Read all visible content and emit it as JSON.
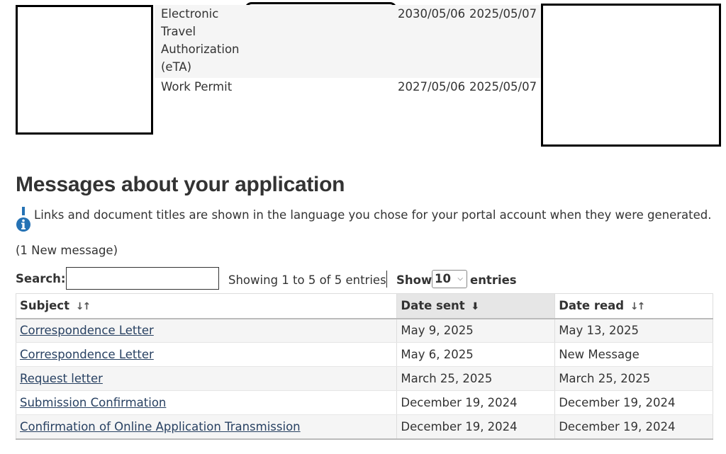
{
  "documents": {
    "rows": [
      {
        "type_lines": [
          "Electronic",
          "Travel",
          "Authorization",
          "(eTA)"
        ],
        "expiry": "2030/05/06",
        "issued": "2025/05/07"
      },
      {
        "type_lines": [
          "Work Permit"
        ],
        "expiry": "2027/05/06",
        "issued": "2025/05/07"
      }
    ]
  },
  "messages": {
    "title": "Messages about your application",
    "note": "Links and document titles are shown in the language you chose for your portal account when they were generated.",
    "new_count": "(1 New message)",
    "search_label": "Search:",
    "search_value": "",
    "showing": "Showing 1 to 5 of 5 entries",
    "show_label": "Show",
    "page_length": "10",
    "entries_label": "entries",
    "columns": [
      "Subject",
      "Date sent",
      "Date read"
    ],
    "rows": [
      {
        "subject": "Correspondence Letter",
        "sent": "May 9, 2025",
        "read": "May 13, 2025"
      },
      {
        "subject": "Correspondence Letter",
        "sent": "May 6, 2025",
        "read": "New Message"
      },
      {
        "subject": "Request letter",
        "sent": "March 25, 2025",
        "read": "March 25, 2025"
      },
      {
        "subject": "Submission Confirmation",
        "sent": "December 19, 2024",
        "read": "December 19, 2024"
      },
      {
        "subject": "Confirmation of Online Application Transmission",
        "sent": "December 19, 2024",
        "read": "December 19, 2024"
      }
    ]
  },
  "colors": {
    "link": "#284162",
    "info_icon": "#2572b4",
    "stripe": "#f5f5f5"
  }
}
